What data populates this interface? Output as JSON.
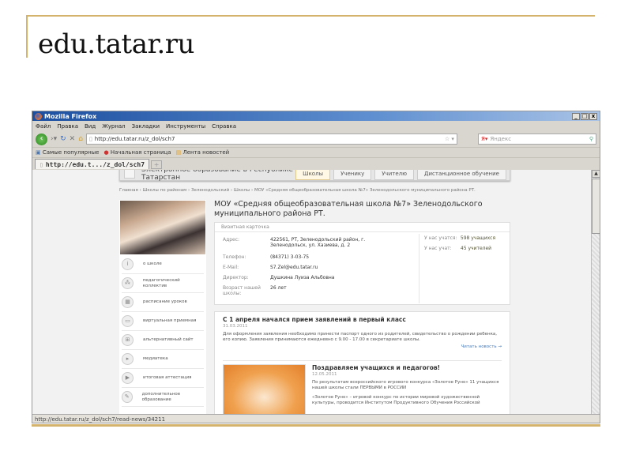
{
  "slide": {
    "title": "edu.tatar.ru",
    "accent": "#d4b46c"
  },
  "browser": {
    "title": "Mozilla Firefox",
    "window_buttons": [
      "_",
      "□",
      "x"
    ],
    "menu": [
      "Файл",
      "Правка",
      "Вид",
      "Журнал",
      "Закладки",
      "Инструменты",
      "Справка"
    ],
    "url": "http://edu.tatar.ru/z_dol/sch7",
    "search_placeholder": "Яндекс",
    "bookmarks": [
      "Самые популярные",
      "Начальная страница",
      "Лента новостей"
    ],
    "tab": "http://edu.t.../z_dol/sch7",
    "newtab": "+",
    "status": "http://edu.tatar.ru/z_dol/sch7/read-news/34211"
  },
  "site": {
    "header": "Электронное образование в Республике Татарстан",
    "tabs": [
      "Школы",
      "Ученику",
      "Учителю",
      "Дистанционное обучение"
    ],
    "breadcrumb": "Главная › Школы по районам › Зеленодольский › Школы › МОУ «Средняя общеобразовательная школа №7» Зеленодольского муниципального района РТ.",
    "menu": [
      "о школе",
      "педагогический коллектив",
      "расписание уроков",
      "виртуальная приемная",
      "альтернативный сайт",
      "медиатека",
      "итоговая аттестация",
      "дополнительное образование"
    ],
    "school_title": "МОУ «Средняя общеобразовательная школа №7» Зеленодольского муниципального района РТ.",
    "card": {
      "heading": "Визитная карточка",
      "fields": [
        {
          "k": "Адрес:",
          "v": "422561, РТ, Зеленодольский район, г. Зеленодольск, ул. Хазиева, д. 2"
        },
        {
          "k": "Телефон:",
          "v": "(84371) 3-03-75"
        },
        {
          "k": "E-Mail:",
          "v": "S7.Zel@edu.tatar.ru"
        },
        {
          "k": "Директор:",
          "v": "Душкина Луиза Альбовна"
        },
        {
          "k": "Возраст нашей школы:",
          "v": "26 лет"
        }
      ],
      "stats": [
        {
          "k": "У нас учатся:",
          "v": "598 учащихся"
        },
        {
          "k": "У нас учат:",
          "v": "45 учителей"
        }
      ]
    },
    "news": [
      {
        "title": "С 1 апреля начался прием заявлений в первый класс",
        "date": "31.03.2011",
        "text": "Для оформления заявления необходимо принести паспорт одного из родителей, свидетельство о рождении ребенка, его копию. Заявления принимаются ежедневно с 9.00 - 17.00 в секретариате школы.",
        "more": "Читать новость →"
      },
      {
        "title": "Поздравляем учащихся и педагогов!",
        "date": "12.05.2011",
        "text": "По результатам всероссийского игрового конкурса «Золотое Руно» 11 учащихся нашей школы стали ПЕРВЫМИ в РОССИИ",
        "text2": "«Золотое Руно» – игровой конкурс по истории мировой художественной культуры, проводится Институтом Продуктивного Обучения Российской"
      }
    ]
  }
}
